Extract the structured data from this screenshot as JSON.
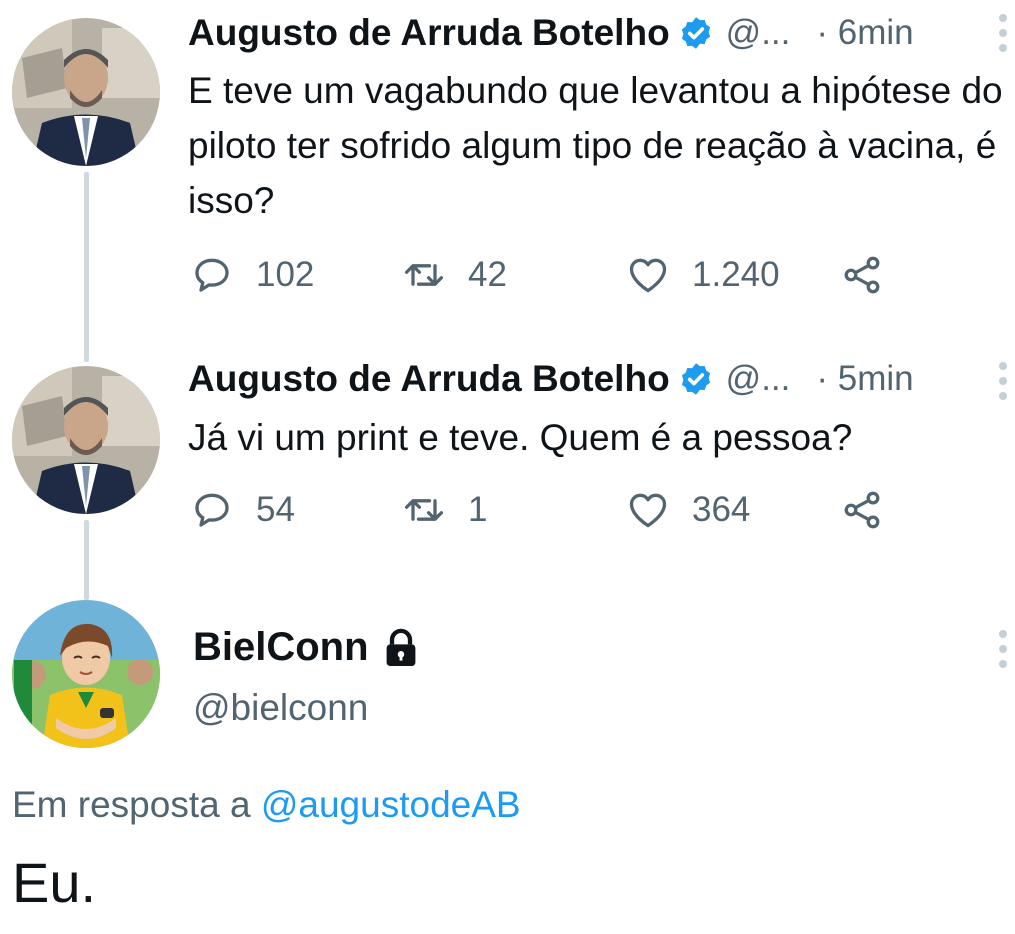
{
  "tweets": [
    {
      "name": "Augusto de Arruda Botelho",
      "handle": "@...",
      "time": "· 6min",
      "text": "E teve um vagabundo que levantou a hipótese do piloto ter sofrido algum tipo de reação à vacina, é isso?",
      "replies": "102",
      "retweets": "42",
      "likes": "1.240"
    },
    {
      "name": "Augusto de Arruda Botelho",
      "handle": "@...",
      "time": "· 5min",
      "text": "Já vi um print e teve. Quem é a pessoa?",
      "replies": "54",
      "retweets": "1",
      "likes": "364"
    }
  ],
  "reply": {
    "name": "BielConn",
    "handle": "@bielconn",
    "in_reply_prefix": "Em resposta a ",
    "in_reply_mention": "@augustodeAB",
    "text": "Eu."
  },
  "icons": {
    "verified": "verified-badge-icon",
    "reply": "speech-bubble-icon",
    "retweet": "retweet-icon",
    "like": "heart-icon",
    "share": "share-icon",
    "lock": "lock-icon",
    "more": "more-vertical-icon"
  },
  "colors": {
    "text": "#0f1419",
    "secondary": "#536471",
    "accent": "#1d9bf0",
    "thread_line": "#cfd9de"
  }
}
